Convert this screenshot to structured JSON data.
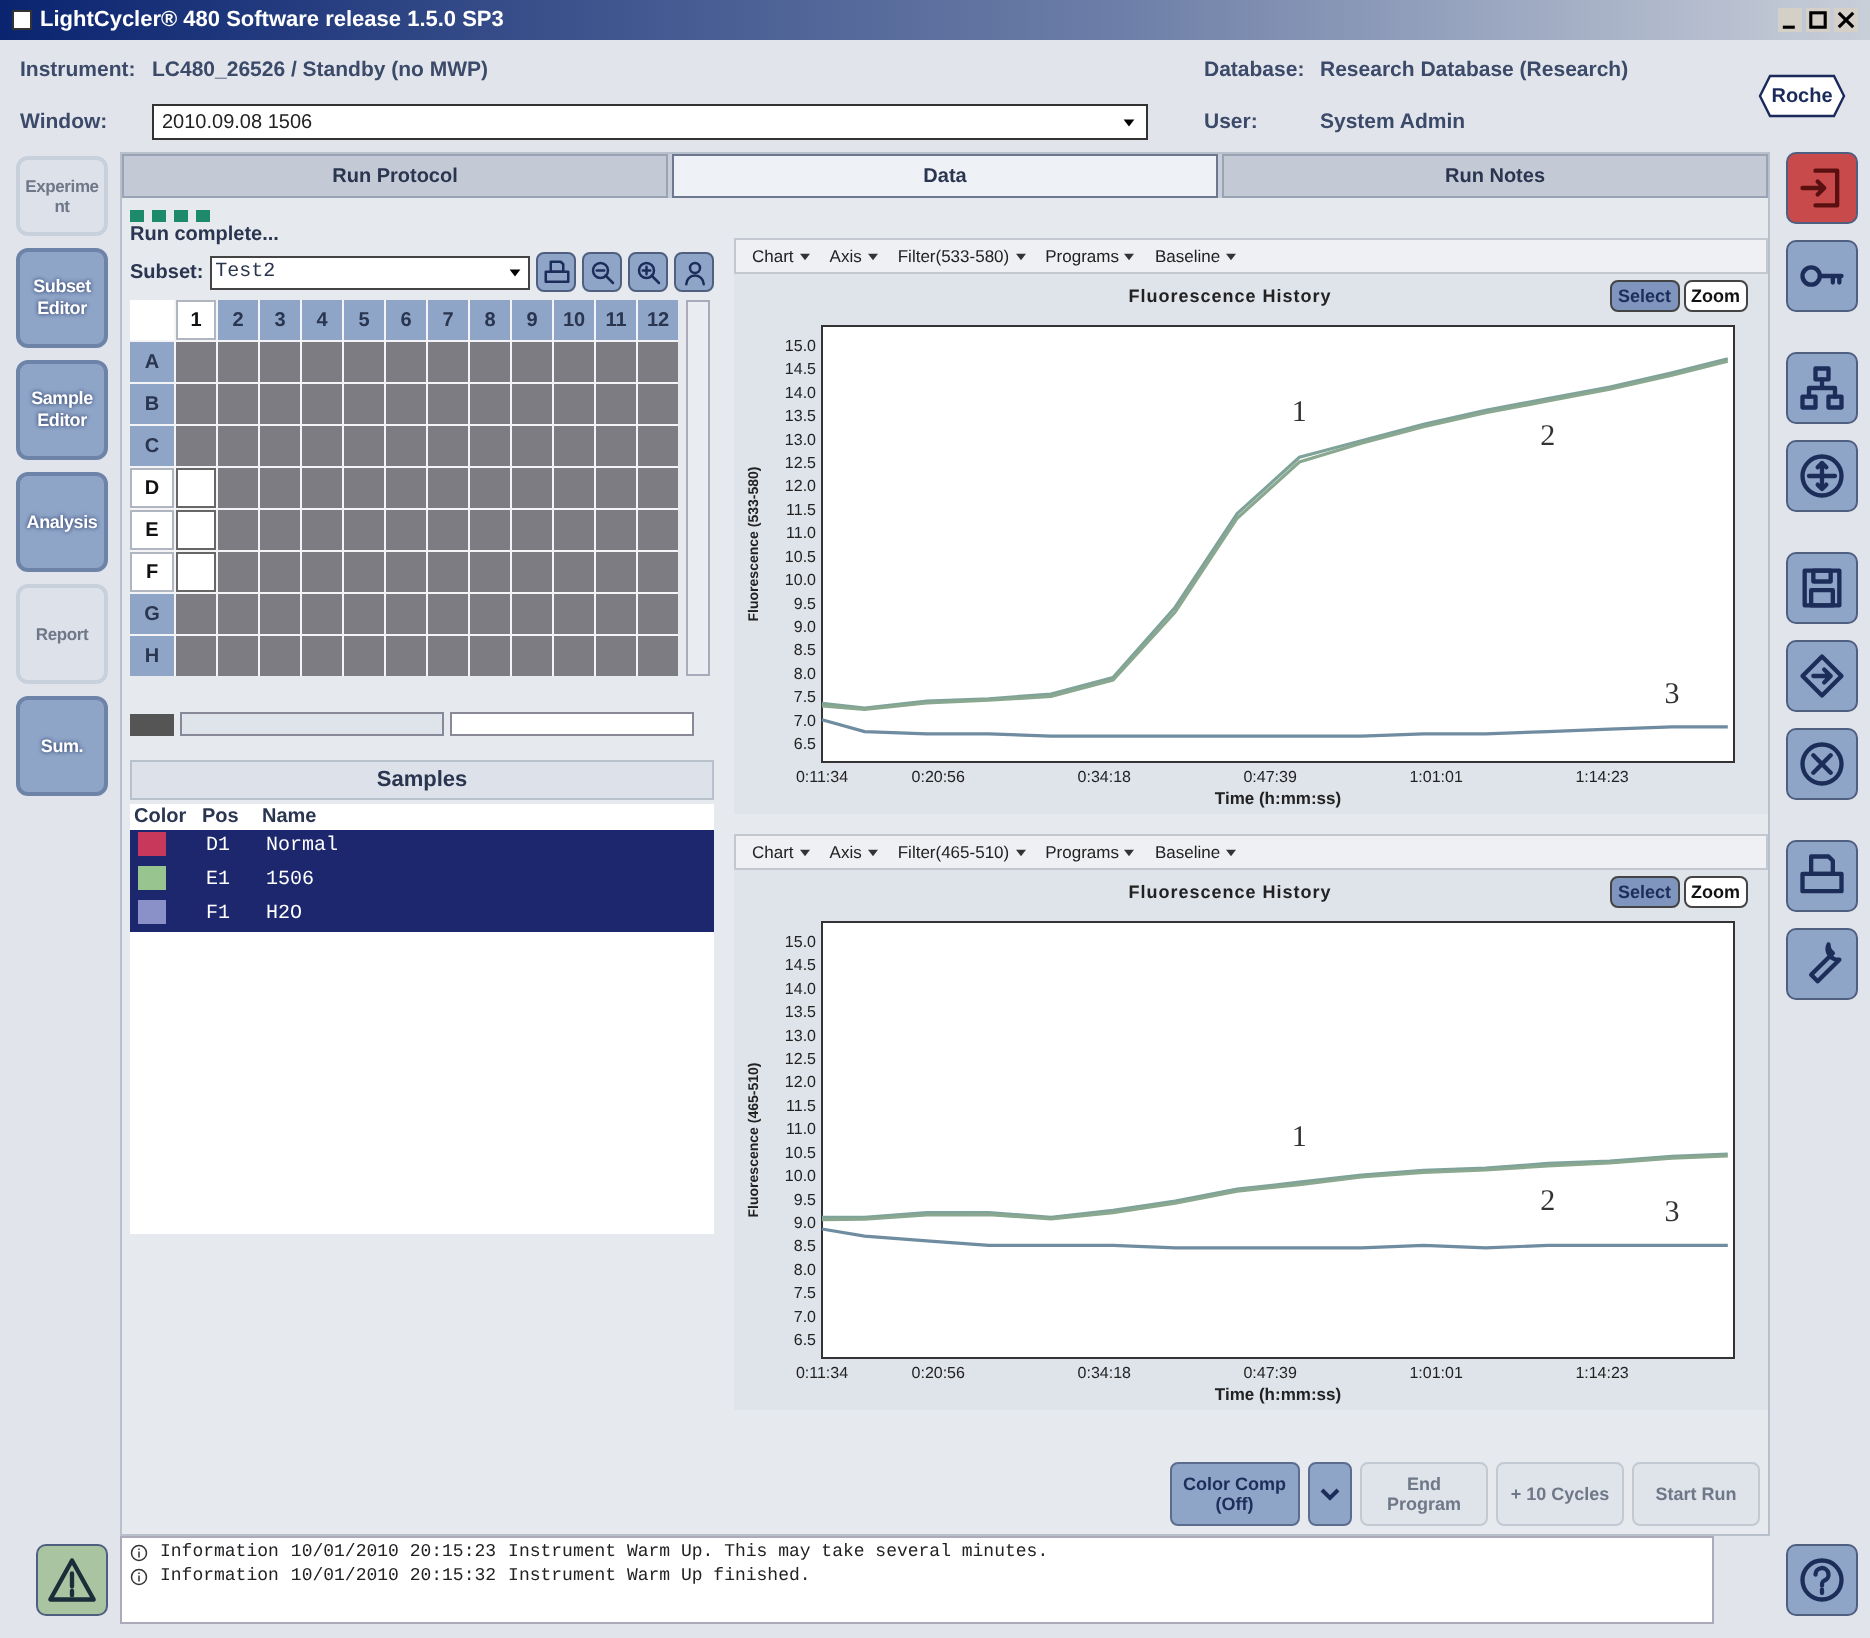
{
  "window": {
    "title": "LightCycler® 480 Software release 1.5.0 SP3"
  },
  "header": {
    "instrument_label": "Instrument:",
    "instrument": "LC480_26526 / Standby (no MWP)",
    "window_label": "Window:",
    "window_value": "2010.09.08 1506",
    "database_label": "Database:",
    "database": "Research Database (Research)",
    "user_label": "User:",
    "user": "System Admin",
    "logo": "Roche"
  },
  "nav": [
    {
      "label": "Experiment",
      "disabled": true
    },
    {
      "label": "Subset Editor",
      "disabled": false
    },
    {
      "label": "Sample Editor",
      "disabled": false
    },
    {
      "label": "Analysis",
      "disabled": false
    },
    {
      "label": "Report",
      "disabled": true
    },
    {
      "label": "Sum.",
      "disabled": false
    }
  ],
  "tabs": [
    {
      "label": "Run Protocol",
      "selected": false
    },
    {
      "label": "Data",
      "selected": true
    },
    {
      "label": "Run Notes",
      "selected": false
    }
  ],
  "run_status": "Run complete...",
  "subset": {
    "label": "Subset:",
    "value": "Test2"
  },
  "plate": {
    "columns": [
      {
        "label": "1",
        "selected": true
      },
      {
        "label": "2",
        "selected": false
      },
      {
        "label": "3",
        "selected": false
      },
      {
        "label": "4",
        "selected": false
      },
      {
        "label": "5",
        "selected": false
      },
      {
        "label": "6",
        "selected": false
      },
      {
        "label": "7",
        "selected": false
      },
      {
        "label": "8",
        "selected": false
      },
      {
        "label": "9",
        "selected": false
      },
      {
        "label": "10",
        "selected": false
      },
      {
        "label": "11",
        "selected": false
      },
      {
        "label": "12",
        "selected": false
      }
    ],
    "rows": [
      {
        "label": "A",
        "selected": false,
        "wells": [
          {
            "selected": false
          },
          {
            "selected": false
          },
          {
            "selected": false
          },
          {
            "selected": false
          },
          {
            "selected": false
          },
          {
            "selected": false
          },
          {
            "selected": false
          },
          {
            "selected": false
          },
          {
            "selected": false
          },
          {
            "selected": false
          },
          {
            "selected": false
          },
          {
            "selected": false
          }
        ]
      },
      {
        "label": "B",
        "selected": false,
        "wells": [
          {
            "selected": false
          },
          {
            "selected": false
          },
          {
            "selected": false
          },
          {
            "selected": false
          },
          {
            "selected": false
          },
          {
            "selected": false
          },
          {
            "selected": false
          },
          {
            "selected": false
          },
          {
            "selected": false
          },
          {
            "selected": false
          },
          {
            "selected": false
          },
          {
            "selected": false
          }
        ]
      },
      {
        "label": "C",
        "selected": false,
        "wells": [
          {
            "selected": false
          },
          {
            "selected": false
          },
          {
            "selected": false
          },
          {
            "selected": false
          },
          {
            "selected": false
          },
          {
            "selected": false
          },
          {
            "selected": false
          },
          {
            "selected": false
          },
          {
            "selected": false
          },
          {
            "selected": false
          },
          {
            "selected": false
          },
          {
            "selected": false
          }
        ]
      },
      {
        "label": "D",
        "selected": true,
        "wells": [
          {
            "selected": true
          },
          {
            "selected": false
          },
          {
            "selected": false
          },
          {
            "selected": false
          },
          {
            "selected": false
          },
          {
            "selected": false
          },
          {
            "selected": false
          },
          {
            "selected": false
          },
          {
            "selected": false
          },
          {
            "selected": false
          },
          {
            "selected": false
          },
          {
            "selected": false
          }
        ]
      },
      {
        "label": "E",
        "selected": true,
        "wells": [
          {
            "selected": true
          },
          {
            "selected": false
          },
          {
            "selected": false
          },
          {
            "selected": false
          },
          {
            "selected": false
          },
          {
            "selected": false
          },
          {
            "selected": false
          },
          {
            "selected": false
          },
          {
            "selected": false
          },
          {
            "selected": false
          },
          {
            "selected": false
          },
          {
            "selected": false
          }
        ]
      },
      {
        "label": "F",
        "selected": true,
        "wells": [
          {
            "selected": true
          },
          {
            "selected": false
          },
          {
            "selected": false
          },
          {
            "selected": false
          },
          {
            "selected": false
          },
          {
            "selected": false
          },
          {
            "selected": false
          },
          {
            "selected": false
          },
          {
            "selected": false
          },
          {
            "selected": false
          },
          {
            "selected": false
          },
          {
            "selected": false
          }
        ]
      },
      {
        "label": "G",
        "selected": false,
        "wells": [
          {
            "selected": false
          },
          {
            "selected": false
          },
          {
            "selected": false
          },
          {
            "selected": false
          },
          {
            "selected": false
          },
          {
            "selected": false
          },
          {
            "selected": false
          },
          {
            "selected": false
          },
          {
            "selected": false
          },
          {
            "selected": false
          },
          {
            "selected": false
          },
          {
            "selected": false
          }
        ]
      },
      {
        "label": "H",
        "selected": false,
        "wells": [
          {
            "selected": false
          },
          {
            "selected": false
          },
          {
            "selected": false
          },
          {
            "selected": false
          },
          {
            "selected": false
          },
          {
            "selected": false
          },
          {
            "selected": false
          },
          {
            "selected": false
          },
          {
            "selected": false
          },
          {
            "selected": false
          },
          {
            "selected": false
          },
          {
            "selected": false
          }
        ]
      }
    ]
  },
  "samples": {
    "title": "Samples",
    "columns": [
      "Color",
      "Pos",
      "Name"
    ],
    "rows": [
      {
        "color": "#c8385a",
        "pos": "D1",
        "name": "Normal",
        "selected": true
      },
      {
        "color": "#98c490",
        "pos": "E1",
        "name": "1506",
        "selected": true
      },
      {
        "color": "#8a90c8",
        "pos": "F1",
        "name": "H2O",
        "selected": true
      }
    ]
  },
  "charts": [
    {
      "toolbar": [
        "Chart",
        "Axis",
        "Filter(533-580)",
        "Programs",
        "Baseline"
      ],
      "modes": [
        {
          "label": "Select",
          "selected": true
        },
        {
          "label": "Zoom",
          "selected": false
        }
      ],
      "chart_data": {
        "type": "line",
        "title": "Fluorescence History",
        "xlabel": "Time (h:mm:ss)",
        "ylabel": "Fluorescence (533-580)",
        "xlim": [
          11.57,
          85
        ],
        "ylim": [
          6.1,
          15.4
        ],
        "xticks": [
          {
            "value": 11.57,
            "label": "0:11:34"
          },
          {
            "value": 20.93,
            "label": "0:20:56"
          },
          {
            "value": 34.3,
            "label": "0:34:18"
          },
          {
            "value": 47.65,
            "label": "0:47:39"
          },
          {
            "value": 61.02,
            "label": "1:01:01"
          },
          {
            "value": 74.38,
            "label": "1:14:23"
          }
        ],
        "yticks": [
          6.5,
          {
            "value": 7,
            "label": "7.0"
          },
          7.5,
          {
            "value": 8,
            "label": "8.0"
          },
          8.5,
          {
            "value": 9,
            "label": "9.0"
          },
          9.5,
          {
            "value": 10,
            "label": "10.0"
          },
          10.5,
          {
            "value": 11,
            "label": "11.0"
          },
          11.5,
          {
            "value": 12,
            "label": "12.0"
          },
          12.5,
          {
            "value": 13,
            "label": "13.0"
          },
          13.5,
          {
            "value": 14,
            "label": "14.0"
          },
          14.5,
          {
            "value": 15,
            "label": "15.0"
          }
        ],
        "x": [
          11.57,
          15,
          20,
          25,
          30,
          35,
          40,
          45,
          50,
          55,
          60,
          65,
          70,
          75,
          80,
          84.5
        ],
        "series": [
          {
            "name": "1",
            "color": "#7fa39a",
            "values": [
              7.35,
              7.25,
              7.4,
              7.45,
              7.55,
              7.9,
              9.4,
              11.4,
              12.6,
              12.95,
              13.3,
              13.6,
              13.85,
              14.1,
              14.4,
              14.7
            ]
          },
          {
            "name": "2",
            "color": "#8aa88f",
            "values": [
              7.3,
              7.22,
              7.36,
              7.42,
              7.5,
              7.85,
              9.3,
              11.3,
              12.5,
              12.9,
              13.25,
              13.55,
              13.8,
              14.05,
              14.35,
              14.65
            ]
          },
          {
            "name": "3",
            "color": "#6f8ca0",
            "values": [
              7.0,
              6.75,
              6.7,
              6.7,
              6.65,
              6.65,
              6.65,
              6.65,
              6.65,
              6.65,
              6.7,
              6.7,
              6.75,
              6.8,
              6.85,
              6.85
            ]
          }
        ]
      }
    },
    {
      "toolbar": [
        "Chart",
        "Axis",
        "Filter(465-510)",
        "Programs",
        "Baseline"
      ],
      "modes": [
        {
          "label": "Select",
          "selected": true
        },
        {
          "label": "Zoom",
          "selected": false
        }
      ],
      "chart_data": {
        "type": "line",
        "title": "Fluorescence History",
        "xlabel": "Time (h:mm:ss)",
        "ylabel": "Fluorescence (465-510)",
        "xlim": [
          11.57,
          85
        ],
        "ylim": [
          6.1,
          15.4
        ],
        "xticks": [
          {
            "value": 11.57,
            "label": "0:11:34"
          },
          {
            "value": 20.93,
            "label": "0:20:56"
          },
          {
            "value": 34.3,
            "label": "0:34:18"
          },
          {
            "value": 47.65,
            "label": "0:47:39"
          },
          {
            "value": 61.02,
            "label": "1:01:01"
          },
          {
            "value": 74.38,
            "label": "1:14:23"
          }
        ],
        "yticks": [
          6.5,
          {
            "value": 7,
            "label": "7.0"
          },
          7.5,
          {
            "value": 8,
            "label": "8.0"
          },
          8.5,
          {
            "value": 9,
            "label": "9.0"
          },
          9.5,
          {
            "value": 10,
            "label": "10.0"
          },
          10.5,
          {
            "value": 11,
            "label": "11.0"
          },
          11.5,
          {
            "value": 12,
            "label": "12.0"
          },
          12.5,
          {
            "value": 13,
            "label": "13.0"
          },
          13.5,
          {
            "value": 14,
            "label": "14.0"
          },
          14.5,
          {
            "value": 15,
            "label": "15.0"
          }
        ],
        "x": [
          11.57,
          15,
          20,
          25,
          30,
          35,
          40,
          45,
          50,
          55,
          60,
          65,
          70,
          75,
          80,
          84.5
        ],
        "series": [
          {
            "name": "1",
            "color": "#7fa39a",
            "values": [
              9.1,
              9.1,
              9.2,
              9.2,
              9.1,
              9.25,
              9.45,
              9.7,
              9.85,
              10.0,
              10.1,
              10.15,
              10.25,
              10.3,
              10.4,
              10.45
            ]
          },
          {
            "name": "2",
            "color": "#8aa88f",
            "values": [
              9.05,
              9.06,
              9.15,
              9.16,
              9.07,
              9.2,
              9.4,
              9.66,
              9.8,
              9.96,
              10.06,
              10.11,
              10.2,
              10.26,
              10.36,
              10.41
            ]
          },
          {
            "name": "3",
            "color": "#6f8ca0",
            "values": [
              8.85,
              8.7,
              8.6,
              8.5,
              8.5,
              8.5,
              8.45,
              8.45,
              8.45,
              8.45,
              8.5,
              8.45,
              8.5,
              8.5,
              8.5,
              8.5
            ]
          }
        ]
      }
    }
  ],
  "actions": [
    {
      "kind": "split",
      "label": "Color Comp",
      "sublabel": "(Off)",
      "disabled": false
    },
    {
      "kind": "button",
      "label": "End Program",
      "disabled": true
    },
    {
      "kind": "button",
      "label": "+ 10 Cycles",
      "disabled": true
    },
    {
      "kind": "button",
      "label": "Start Run",
      "disabled": true
    }
  ],
  "log": [
    {
      "level": "Information",
      "time": "10/01/2010 20:15:23",
      "message": "Instrument Warm Up. This may take several minutes."
    },
    {
      "level": "Information",
      "time": "10/01/2010 20:15:32",
      "message": "Instrument Warm Up finished."
    }
  ]
}
